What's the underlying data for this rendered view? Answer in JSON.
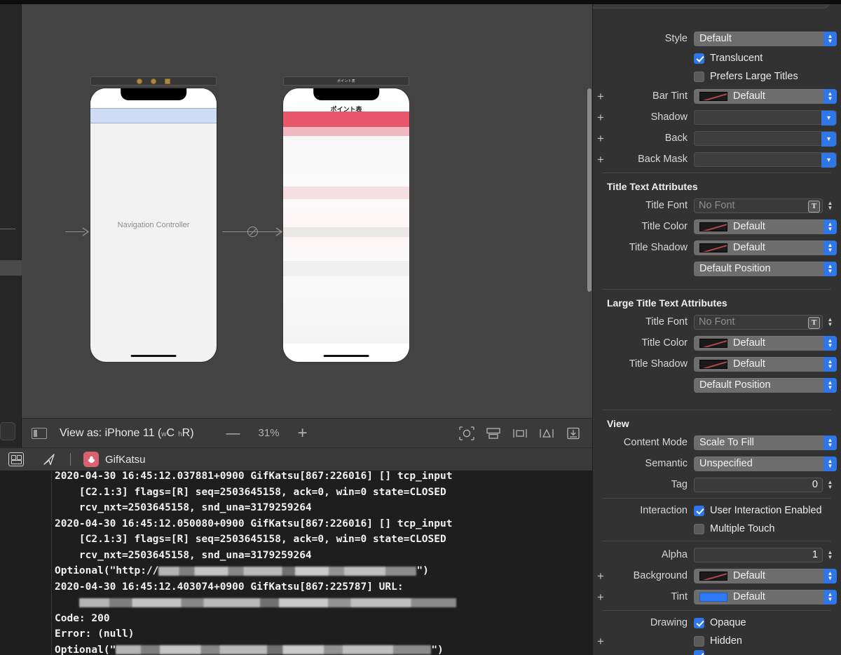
{
  "window": {
    "app": "Xcode Interface Builder"
  },
  "canvas": {
    "scene1": {
      "dock_icons": [
        "view-controller-icon",
        "first-responder-icon",
        "exit-icon"
      ],
      "label": "Navigation Controller"
    },
    "scene2": {
      "dock_title": "ポイント表",
      "nav_title": "ポイント表"
    }
  },
  "canvas_toolbar": {
    "layout_icon": "layout-panel-icon",
    "view_as": "View as: iPhone 11 (",
    "view_as_w": "w",
    "view_as_wc": "C",
    "view_as_h": "h",
    "view_as_hr": "R",
    "view_as_close": ")",
    "zoom_out": "—",
    "zoom_level": "31%",
    "zoom_in": "+",
    "icons": [
      "update-frames-icon",
      "embed-in-icon",
      "align-icon",
      "add-constraints-icon",
      "resolve-issues-icon"
    ]
  },
  "debug_bar": {
    "console_toggle_icon": "debug-area-icon",
    "location_icon": "simulate-location-icon",
    "app_icon": "gifkatsu-app-icon",
    "app_name": "GifKatsu"
  },
  "console": {
    "lines": [
      {
        "type": "text",
        "text": "2020-04-30 16:45:12.037881+0900 GifKatsu[867:226016] [] tcp_input"
      },
      {
        "type": "text",
        "text": "    [C2.1:3] flags=[R] seq=2503645158, ack=0, win=0 state=CLOSED"
      },
      {
        "type": "text",
        "text": "    rcv_nxt=2503645158, snd_una=3179259264"
      },
      {
        "type": "text",
        "text": "2020-04-30 16:45:12.050080+0900 GifKatsu[867:226016] [] tcp_input"
      },
      {
        "type": "text",
        "text": "    [C2.1:3] flags=[R] seq=2503645158, ack=0, win=0 state=CLOSED"
      },
      {
        "type": "text",
        "text": "    rcv_nxt=2503645158, snd_una=3179259264"
      },
      {
        "type": "mixed",
        "prefix": "Optional(\"http://",
        "redacted_width": 368,
        "suffix": "\")"
      },
      {
        "type": "text",
        "text": "2020-04-30 16:45:12.403074+0900 GifKatsu[867:225787] URL:"
      },
      {
        "type": "mixed",
        "prefix": "    ",
        "redacted_width": 538,
        "suffix": ""
      },
      {
        "type": "text",
        "text": "Code: 200"
      },
      {
        "type": "text",
        "text": "Error: (null)"
      },
      {
        "type": "mixed",
        "prefix": "Optional(\"",
        "redacted_width": 450,
        "suffix": "\")"
      }
    ]
  },
  "inspector": {
    "navigation_bar": {
      "style_label": "Style",
      "style_value": "Default",
      "translucent_label": "Translucent",
      "translucent_checked": true,
      "prefers_large_titles_label": "Prefers Large Titles",
      "prefers_large_titles_checked": false,
      "bar_tint_label": "Bar Tint",
      "bar_tint_value": "Default",
      "shadow_label": "Shadow",
      "shadow_value": "",
      "back_label": "Back",
      "back_value": "",
      "back_mask_label": "Back Mask",
      "back_mask_value": ""
    },
    "title_text_attributes": {
      "section": "Title Text Attributes",
      "title_font_label": "Title Font",
      "title_font_value": "No Font",
      "title_color_label": "Title Color",
      "title_color_value": "Default",
      "title_shadow_label": "Title Shadow",
      "title_shadow_value": "Default",
      "position_value": "Default Position"
    },
    "large_title_text_attributes": {
      "section": "Large Title Text Attributes",
      "title_font_label": "Title Font",
      "title_font_value": "No Font",
      "title_color_label": "Title Color",
      "title_color_value": "Default",
      "title_shadow_label": "Title Shadow",
      "title_shadow_value": "Default",
      "position_value": "Default Position"
    },
    "view": {
      "section": "View",
      "content_mode_label": "Content Mode",
      "content_mode_value": "Scale To Fill",
      "semantic_label": "Semantic",
      "semantic_value": "Unspecified",
      "tag_label": "Tag",
      "tag_value": "0",
      "interaction_label": "Interaction",
      "user_interaction_label": "User Interaction Enabled",
      "user_interaction_checked": true,
      "multiple_touch_label": "Multiple Touch",
      "multiple_touch_checked": false,
      "alpha_label": "Alpha",
      "alpha_value": "1",
      "background_label": "Background",
      "background_value": "Default",
      "tint_label": "Tint",
      "tint_value": "Default",
      "drawing_label": "Drawing",
      "opaque_label": "Opaque",
      "opaque_checked": true,
      "hidden_label": "Hidden",
      "hidden_checked": false
    },
    "plus": "+"
  },
  "colors": {
    "accent_blue": "#2f76e8",
    "tint_blue": "#2f7bf6",
    "nav_preview_blue": "#cfdcf5",
    "scene2_red": "#e8566b",
    "app_icon_red": "#d9626e"
  }
}
